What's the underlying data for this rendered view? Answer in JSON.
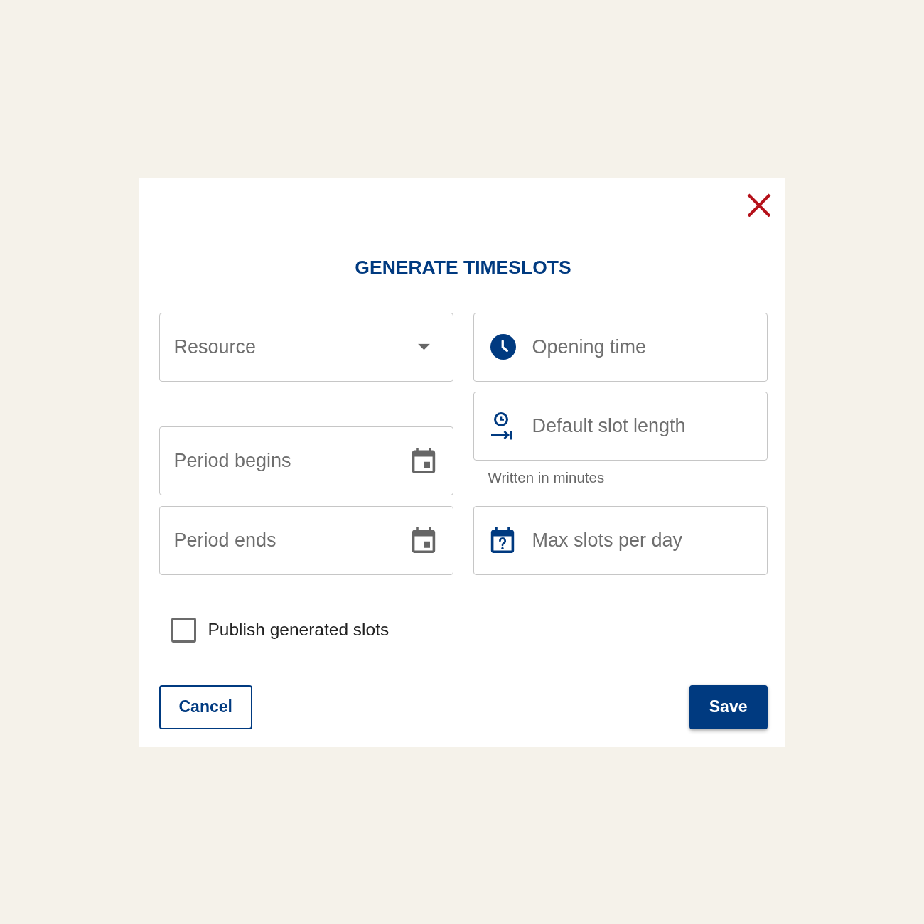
{
  "dialog": {
    "title": "GENERATE TIMESLOTS",
    "left_fields": [
      {
        "kind": "select",
        "placeholder": "Resource"
      },
      {
        "kind": "date",
        "placeholder": "Period begins"
      },
      {
        "kind": "date",
        "placeholder": "Period ends"
      }
    ],
    "right_fields": [
      {
        "kind": "time",
        "placeholder": "Opening time"
      },
      {
        "kind": "duration",
        "placeholder": "Default slot length",
        "helper": "Written in minutes"
      },
      {
        "kind": "count",
        "placeholder": "Max slots per day"
      }
    ],
    "checkbox": {
      "label": "Publish generated slots",
      "checked": false
    },
    "buttons": [
      {
        "kind": "outline",
        "label": "Cancel"
      },
      {
        "kind": "primary",
        "label": "Save"
      }
    ]
  }
}
